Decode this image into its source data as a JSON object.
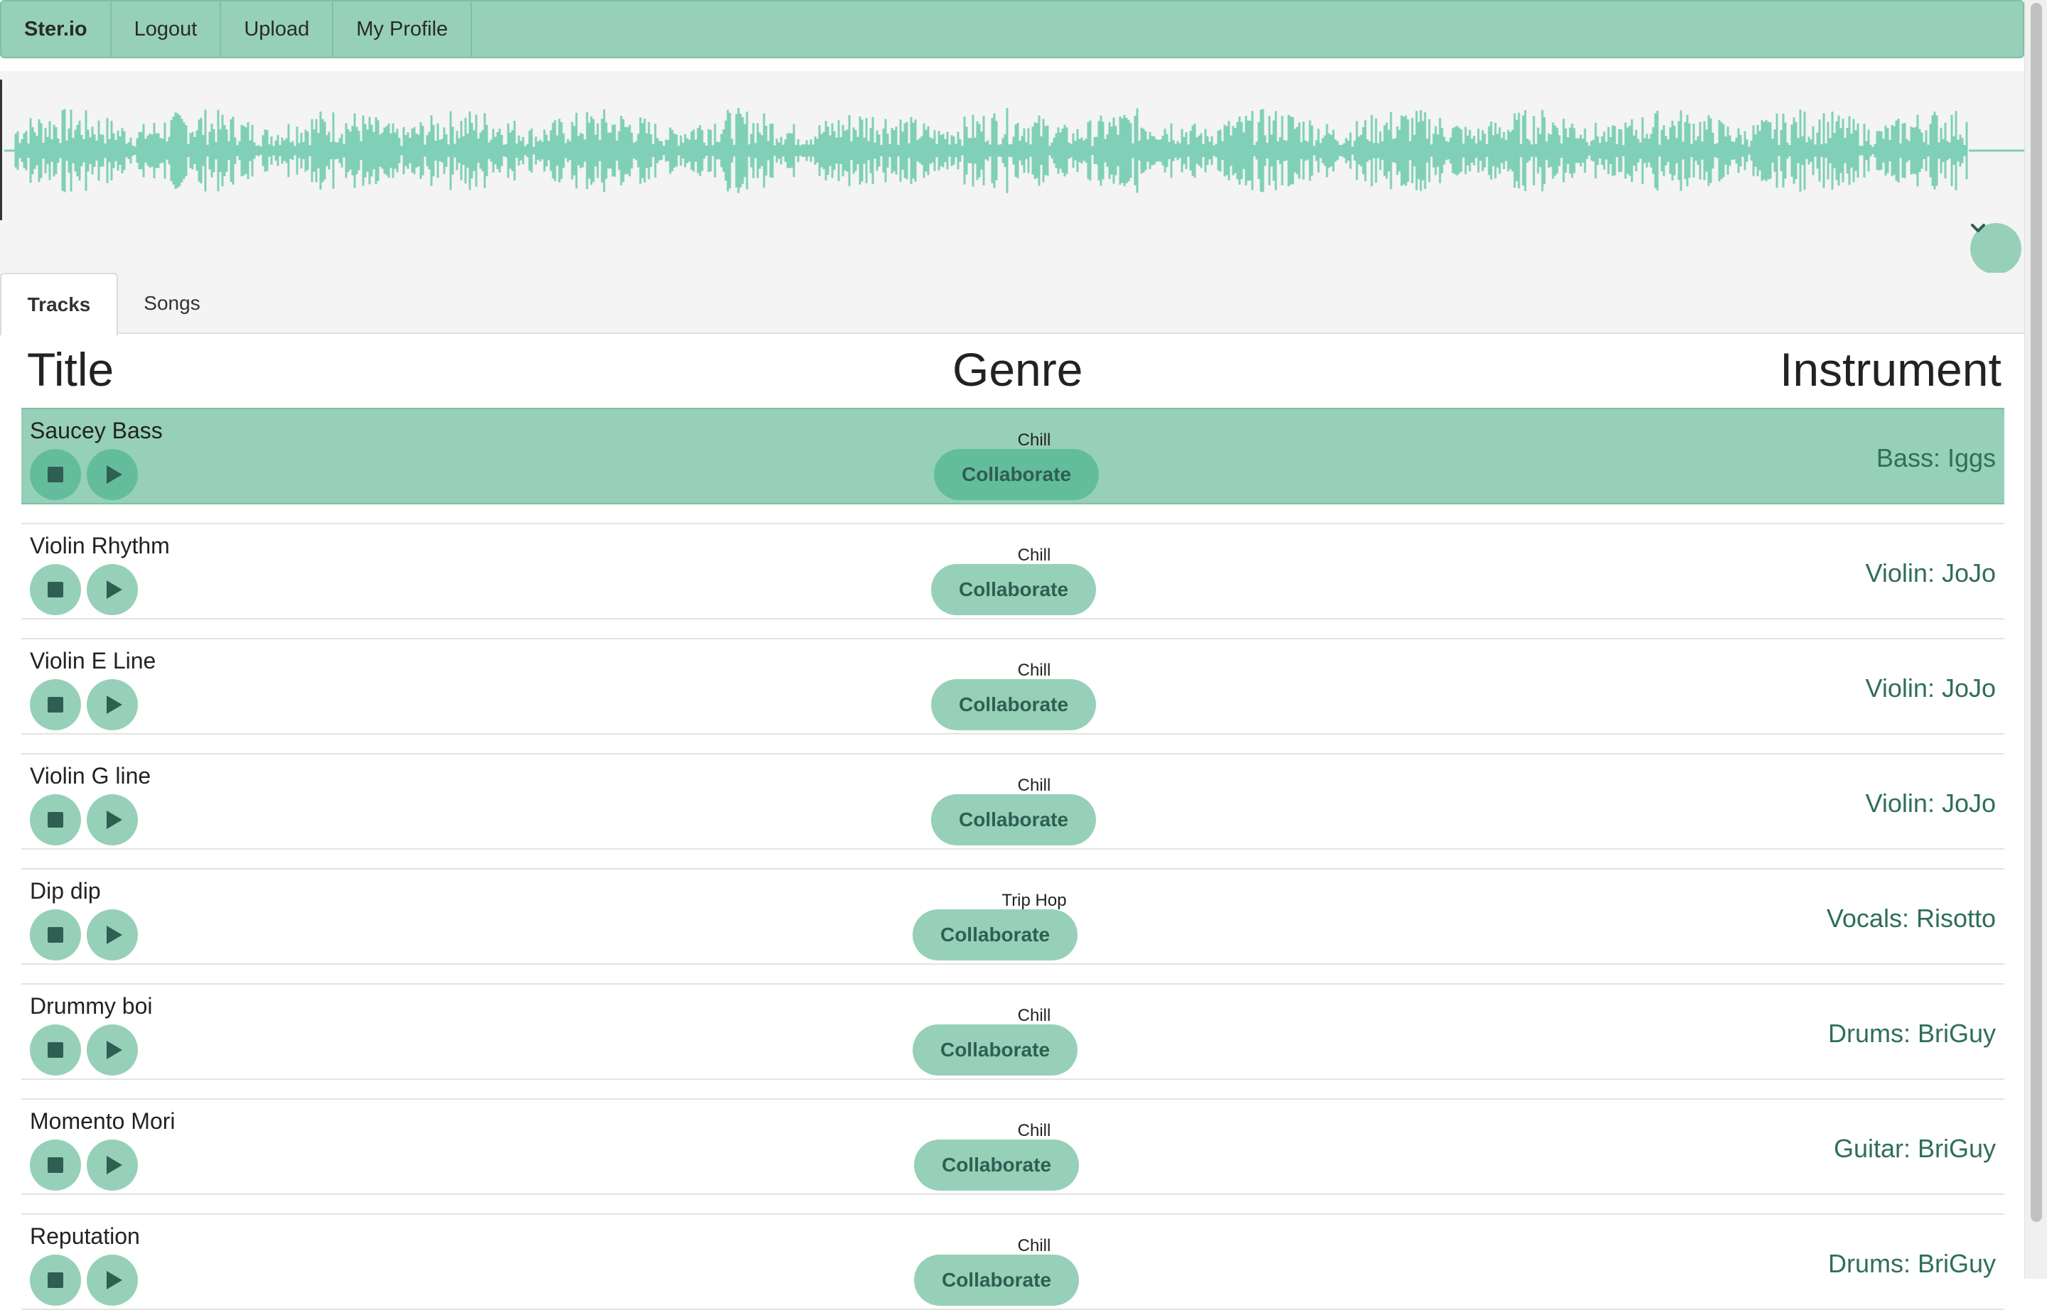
{
  "nav": {
    "brand": "Ster.io",
    "items": [
      "Logout",
      "Upload",
      "My Profile"
    ]
  },
  "player": {
    "waveform_color": "#7fd0b6",
    "expand_icon": "chevron-down-icon"
  },
  "tabs": [
    "Tracks",
    "Songs"
  ],
  "headers": {
    "title": "Title",
    "genre": "Genre",
    "instrument": "Instrument"
  },
  "tracks": [
    {
      "title": "Saucey Bass",
      "genre": "Chill",
      "collab_label": "Collaborate",
      "instrument": "Bass: Iggs",
      "selected": true
    },
    {
      "title": "Violin Rhythm",
      "genre": "Chill",
      "collab_label": "Collaborate",
      "instrument": "Violin: JoJo"
    },
    {
      "title": "Violin E Line",
      "genre": "Chill",
      "collab_label": "Collaborate",
      "instrument": "Violin: JoJo"
    },
    {
      "title": "Violin G line",
      "genre": "Chill",
      "collab_label": "Collaborate",
      "instrument": "Violin: JoJo"
    },
    {
      "title": "Dip dip",
      "genre": "Trip Hop",
      "collab_label": "Collaborate",
      "instrument": "Vocals: Risotto"
    },
    {
      "title": "Drummy boi",
      "genre": "Chill",
      "collab_label": "Collaborate",
      "instrument": "Drums: BriGuy"
    },
    {
      "title": "Momento Mori",
      "genre": "Chill",
      "collab_label": "Collaborate",
      "instrument": "Guitar: BriGuy"
    },
    {
      "title": "Reputation",
      "genre": "Chill",
      "collab_label": "Collaborate",
      "instrument": "Drums: BriGuy"
    }
  ],
  "colors": {
    "accent": "#96d0b9",
    "accent_dark": "#63bd9c",
    "text_accent": "#2f6e5a"
  }
}
